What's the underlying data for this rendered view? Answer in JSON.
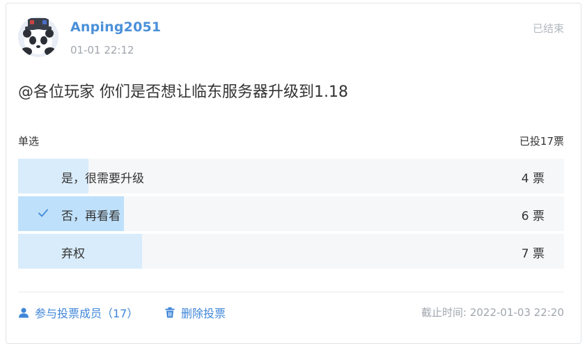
{
  "post": {
    "author": "Anping2051",
    "time": "01-01 22:12",
    "status": "已结束",
    "question": "@各位玩家 你们是否想让临东服务器升级到1.18"
  },
  "poll": {
    "type_label": "单选",
    "total_label": "已投17票",
    "total_votes": 17,
    "options": [
      {
        "label": "是，很需要升级",
        "votes": 4,
        "count_label": "4 票",
        "selected": false
      },
      {
        "label": "否，再看看",
        "votes": 6,
        "count_label": "6 票",
        "selected": true
      },
      {
        "label": "弃权",
        "votes": 7,
        "count_label": "7 票",
        "selected": false
      }
    ]
  },
  "footer": {
    "members_link": "参与投票成员（17）",
    "delete_link": "删除投票",
    "deadline": "截止时间: 2022-01-03 22:20"
  },
  "icons": {
    "avatar": "panda-avatar-icon",
    "check": "check-icon",
    "user": "user-icon",
    "trash": "trash-icon"
  },
  "colors": {
    "accent": "#4a90d9",
    "link": "#3f86d8",
    "bar": "#d9ecfb",
    "bar_selected": "#bfe0fa",
    "track": "#f6f7f9"
  }
}
